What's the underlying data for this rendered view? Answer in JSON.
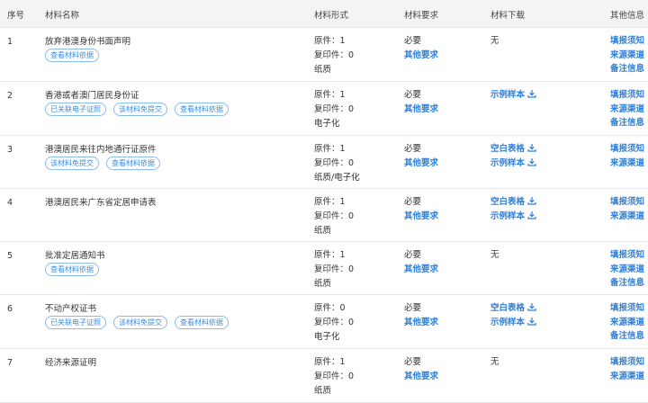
{
  "headers": {
    "no": "序号",
    "name": "材料名称",
    "form": "材料形式",
    "req": "材料要求",
    "download": "材料下载",
    "other": "其他信息"
  },
  "rows": [
    {
      "no": "1",
      "name": "放弃港澳身份书面声明",
      "tags": [
        "查看材料依据"
      ],
      "form": [
        "原件：1",
        "复印件：0",
        "纸质"
      ],
      "req": "必要",
      "req_link": "其他要求",
      "download": [
        "无"
      ],
      "other": [
        "填报须知",
        "来源渠道",
        "备注信息"
      ]
    },
    {
      "no": "2",
      "name": "香港或者澳门居民身份证",
      "tags": [
        "已关联电子证照",
        "该材料免提交",
        "查看材料依据"
      ],
      "form": [
        "原件：1",
        "复印件：0",
        "电子化"
      ],
      "req": "必要",
      "req_link": "其他要求",
      "download": [
        "示例样本"
      ],
      "other": [
        "填报须知",
        "来源渠道",
        "备注信息"
      ]
    },
    {
      "no": "3",
      "name": "港澳居民来往内地通行证原件",
      "tags": [
        "该材料免提交",
        "查看材料依据"
      ],
      "form": [
        "原件：1",
        "复印件：0",
        "纸质/电子化"
      ],
      "req": "必要",
      "req_link": "其他要求",
      "download": [
        "空白表格",
        "示例样本"
      ],
      "other": [
        "填报须知",
        "来源渠道"
      ]
    },
    {
      "no": "4",
      "name": "港澳居民来广东省定居申请表",
      "tags": [],
      "form": [
        "原件：1",
        "复印件：0",
        "纸质"
      ],
      "req": "必要",
      "req_link": "其他要求",
      "download": [
        "空白表格",
        "示例样本"
      ],
      "other": [
        "填报须知",
        "来源渠道"
      ]
    },
    {
      "no": "5",
      "name": "批准定居通知书",
      "tags": [
        "查看材料依据"
      ],
      "form": [
        "原件：1",
        "复印件：0",
        "纸质"
      ],
      "req": "必要",
      "req_link": "其他要求",
      "download": [
        "无"
      ],
      "other": [
        "填报须知",
        "来源渠道",
        "备注信息"
      ]
    },
    {
      "no": "6",
      "name": "不动产权证书",
      "tags": [
        "已关联电子证照",
        "该材料免提交",
        "查看材料依据"
      ],
      "form": [
        "原件：0",
        "复印件：0",
        "电子化"
      ],
      "req": "必要",
      "req_link": "其他要求",
      "download": [
        "空白表格",
        "示例样本"
      ],
      "other": [
        "填报须知",
        "来源渠道",
        "备注信息"
      ]
    },
    {
      "no": "7",
      "name": "经济来源证明",
      "tags": [],
      "form": [
        "原件：1",
        "复印件：0",
        "纸质"
      ],
      "req": "必要",
      "req_link": "其他要求",
      "download": [
        "无"
      ],
      "other": [
        "填报须知",
        "来源渠道"
      ]
    }
  ],
  "colors": {
    "link": "#2f7fd6",
    "tag_border": "#8bbcf0",
    "header_bg": "#f3f4f6"
  },
  "icons": {
    "download": "download-icon"
  }
}
